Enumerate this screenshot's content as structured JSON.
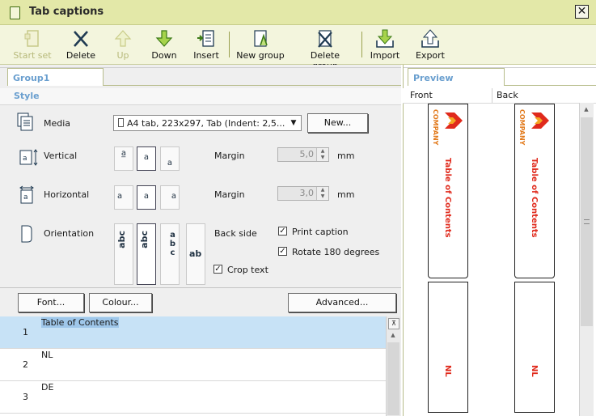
{
  "window": {
    "title": "Tab captions",
    "close_symbol": "✕"
  },
  "toolbar": {
    "items": [
      {
        "label": "Start set",
        "icon": "start-set-icon",
        "enabled": false
      },
      {
        "label": "Delete",
        "icon": "delete-icon",
        "enabled": true
      },
      {
        "label": "Up",
        "icon": "arrow-up-icon",
        "enabled": false
      },
      {
        "label": "Down",
        "icon": "arrow-down-icon",
        "enabled": true
      },
      {
        "label": "Insert",
        "icon": "insert-icon",
        "enabled": true
      },
      {
        "label": "New group",
        "icon": "new-group-icon",
        "enabled": true
      },
      {
        "label": "Delete group",
        "icon": "delete-group-icon",
        "enabled": true
      },
      {
        "label": "Import",
        "icon": "import-icon",
        "enabled": true
      },
      {
        "label": "Export",
        "icon": "export-icon",
        "enabled": true
      }
    ]
  },
  "left": {
    "tab": "Group1",
    "section": "Style",
    "media": {
      "label": "Media",
      "value": "A4 tab, 223x297, Tab (Indent: 2,5...",
      "new_button": "New..."
    },
    "vertical": {
      "label": "Vertical",
      "margin_label": "Margin",
      "margin_value": "5,0",
      "unit": "mm"
    },
    "horizontal": {
      "label": "Horizontal",
      "margin_label": "Margin",
      "margin_value": "3,0",
      "unit": "mm"
    },
    "orientation": {
      "label": "Orientation",
      "options": [
        "abc",
        "abc",
        "abc",
        "ab"
      ],
      "back_side_label": "Back side",
      "print_caption": "Print caption",
      "rotate": "Rotate 180 degrees",
      "crop": "Crop text"
    },
    "buttons": {
      "font": "Font...",
      "colour": "Colour...",
      "advanced": "Advanced..."
    },
    "captions": [
      {
        "num": "1",
        "text": "Table of Contents",
        "selected": true
      },
      {
        "num": "2",
        "text": "NL",
        "selected": false
      },
      {
        "num": "3",
        "text": "DE",
        "selected": false
      }
    ]
  },
  "preview": {
    "tab": "Preview",
    "front_label": "Front",
    "back_label": "Back",
    "company": "COMPANY",
    "caption1": "Table of Contents",
    "caption2": "NL"
  },
  "colors": {
    "titlebar": "#e3e8a8",
    "toolbar": "#f3f5dd",
    "accent_blue": "#6a9fcf",
    "selection": "#c7e2f6",
    "red_text": "#e02a1c"
  }
}
